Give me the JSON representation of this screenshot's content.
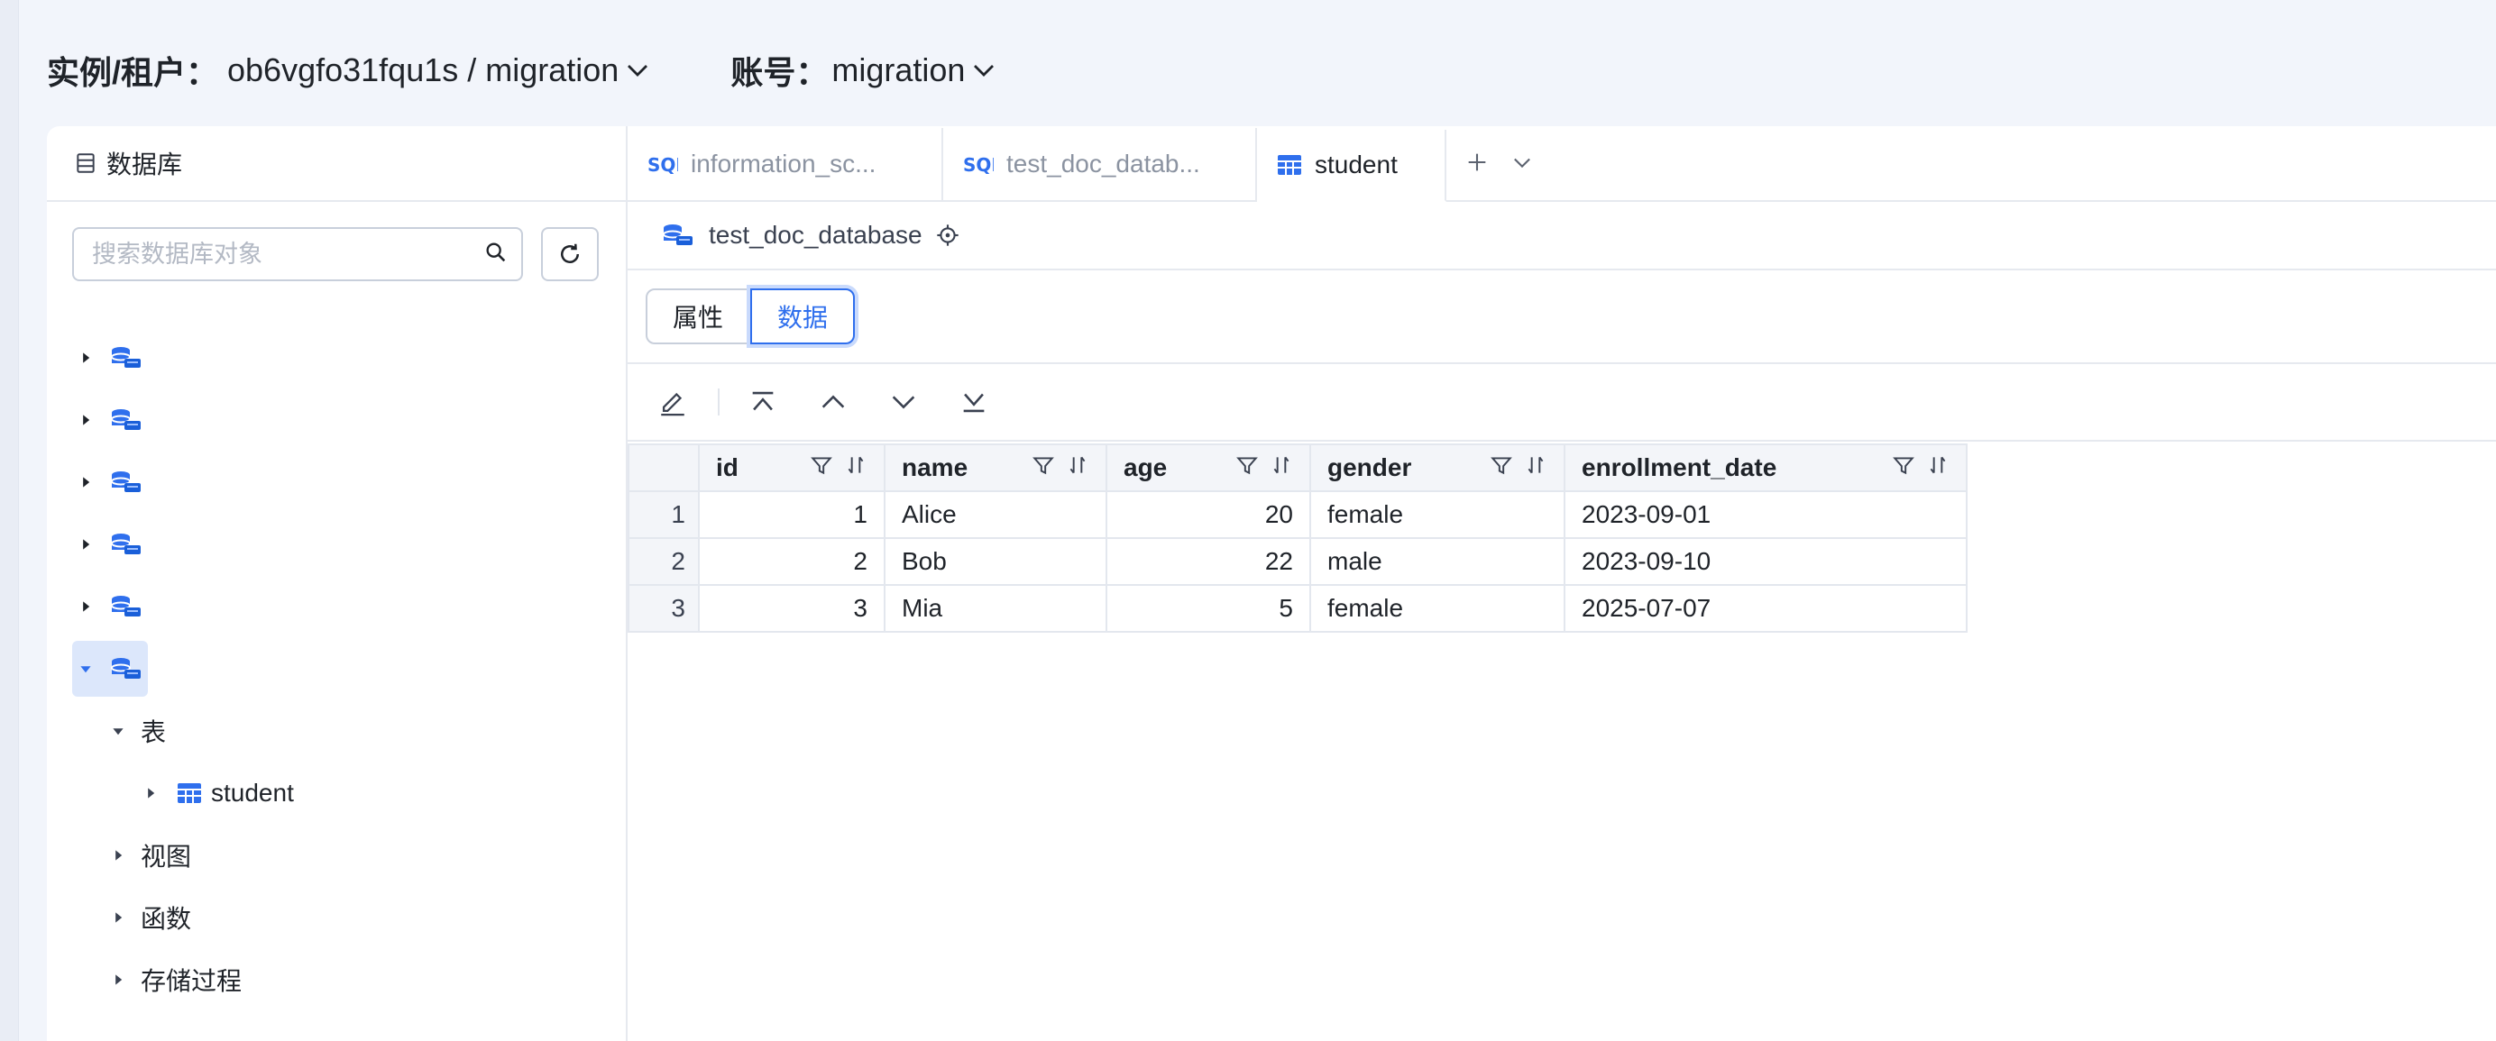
{
  "header": {
    "instance_label": "实例/租户：",
    "instance_value": "ob6vgfo31fqu1s / migration",
    "account_label": "账号：",
    "account_value": "migration"
  },
  "sidebar": {
    "title": "数据库",
    "search_placeholder": "搜索数据库对象",
    "databases": [
      {
        "name": ""
      },
      {
        "name": ""
      },
      {
        "name": ""
      },
      {
        "name": ""
      },
      {
        "name": ""
      },
      {
        "name": ""
      }
    ],
    "groups": {
      "tables": "表",
      "table_items": [
        "student"
      ],
      "views": "视图",
      "functions": "函数",
      "procedures": "存储过程"
    }
  },
  "tabs": [
    {
      "label": "information_sc...",
      "type": "sql"
    },
    {
      "label": "test_doc_datab...",
      "type": "sql"
    },
    {
      "label": "student",
      "type": "table",
      "active": true
    }
  ],
  "breadcrumb": {
    "database": "test_doc_database"
  },
  "segments": {
    "props": "属性",
    "data": "数据"
  },
  "grid": {
    "columns": [
      "id",
      "name",
      "age",
      "gender",
      "enrollment_date"
    ],
    "rows": [
      {
        "num": "1",
        "id": "1",
        "name": "Alice",
        "age": "20",
        "gender": "female",
        "enrollment_date": "2023-09-01"
      },
      {
        "num": "2",
        "id": "2",
        "name": "Bob",
        "age": "22",
        "gender": "male",
        "enrollment_date": "2023-09-10"
      },
      {
        "num": "3",
        "id": "3",
        "name": "Mia",
        "age": "5",
        "gender": "female",
        "enrollment_date": "2025-07-07"
      }
    ]
  },
  "colors": {
    "accent": "#2f6fed",
    "border": "#e3e7ee",
    "header_bg": "#f3f5f9"
  }
}
